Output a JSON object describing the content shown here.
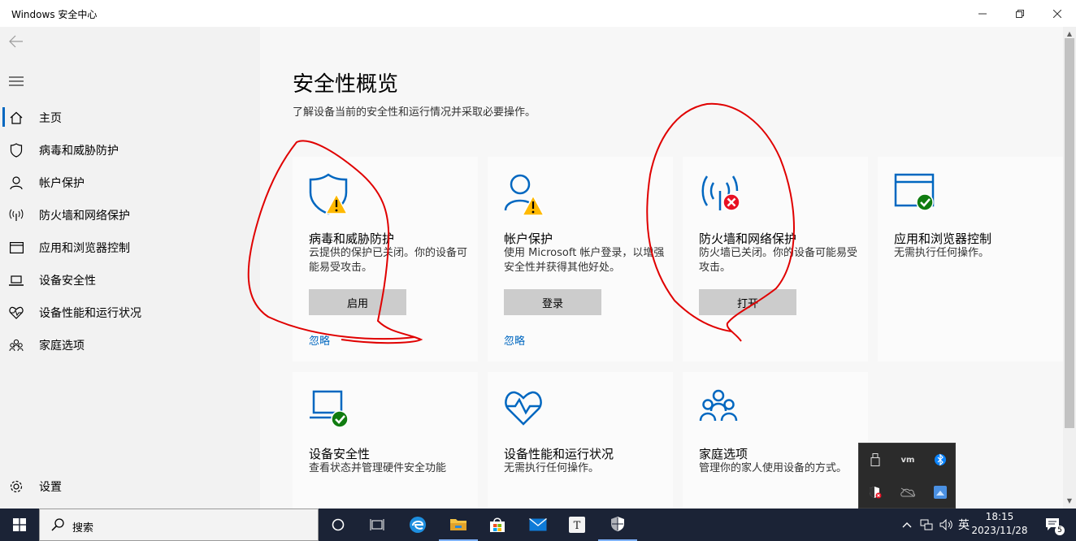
{
  "window": {
    "title": "Windows 安全中心",
    "minimize_icon": "minimize-icon",
    "maximize_icon": "restore-icon",
    "close_icon": "close-icon"
  },
  "sidebar": {
    "back_icon": "back-arrow-icon",
    "menu_icon": "hamburger-menu-icon",
    "items": [
      {
        "label": "主页",
        "icon": "home-icon",
        "selected": true
      },
      {
        "label": "病毒和威胁防护",
        "icon": "shield-icon"
      },
      {
        "label": "帐户保护",
        "icon": "person-icon"
      },
      {
        "label": "防火墙和网络保护",
        "icon": "wireless-signal-icon"
      },
      {
        "label": "应用和浏览器控制",
        "icon": "browser-window-icon"
      },
      {
        "label": "设备安全性",
        "icon": "laptop-icon"
      },
      {
        "label": "设备性能和运行状况",
        "icon": "heart-pulse-icon"
      },
      {
        "label": "家庭选项",
        "icon": "family-icon"
      }
    ],
    "settings": {
      "label": "设置",
      "icon": "gear-icon"
    }
  },
  "main": {
    "title": "安全性概览",
    "subtitle": "了解设备当前的安全性和运行情况并采取必要操作。",
    "cards": [
      {
        "title": "病毒和威胁防护",
        "description": "云提供的保护已关闭。你的设备可能易受攻击。",
        "button": "启用",
        "link": "忽略",
        "icon": "shield-warning-icon",
        "status": "warning"
      },
      {
        "title": "帐户保护",
        "description": "使用 Microsoft 帐户登录，以增强安全性并获得其他好处。",
        "button": "登录",
        "link": "忽略",
        "icon": "person-warning-icon",
        "status": "warning"
      },
      {
        "title": "防火墙和网络保护",
        "description": "防火墙已关闭。你的设备可能易受攻击。",
        "button": "打开",
        "icon": "wireless-error-icon",
        "status": "error"
      },
      {
        "title": "应用和浏览器控制",
        "description": "无需执行任何操作。",
        "icon": "browser-ok-icon",
        "status": "ok"
      },
      {
        "title": "设备安全性",
        "description": "查看状态并管理硬件安全功能",
        "icon": "laptop-ok-icon",
        "status": "ok"
      },
      {
        "title": "设备性能和运行状况",
        "description": "无需执行任何操作。",
        "icon": "heart-pulse-icon",
        "status": "none"
      },
      {
        "title": "家庭选项",
        "description": "管理你的家人使用设备的方式。",
        "icon": "family-icon",
        "status": "none"
      }
    ]
  },
  "colors": {
    "accent": "#0067c0",
    "warning": "#ffb900",
    "error": "#e81123",
    "ok": "#107c10",
    "annotation": "#e00000"
  },
  "taskbar": {
    "search_placeholder": "搜索",
    "apps": [
      "task-view-icon",
      "edge-icon",
      "file-explorer-icon",
      "store-icon",
      "mail-icon",
      "typora-icon",
      "windows-security-icon"
    ],
    "tray": {
      "overflow_icon": "chevron-up-icon",
      "network_icon": "network-icon",
      "volume_icon": "volume-icon",
      "ime": "英",
      "time": "18:15",
      "date": "2023/11/28",
      "notifications_count": "5"
    },
    "tray_popup_icons": [
      "usb-icon",
      "vmware-icon",
      "bluetooth-icon",
      "security-shield-error-icon",
      "onedrive-icon",
      "app-tray-icon"
    ]
  }
}
